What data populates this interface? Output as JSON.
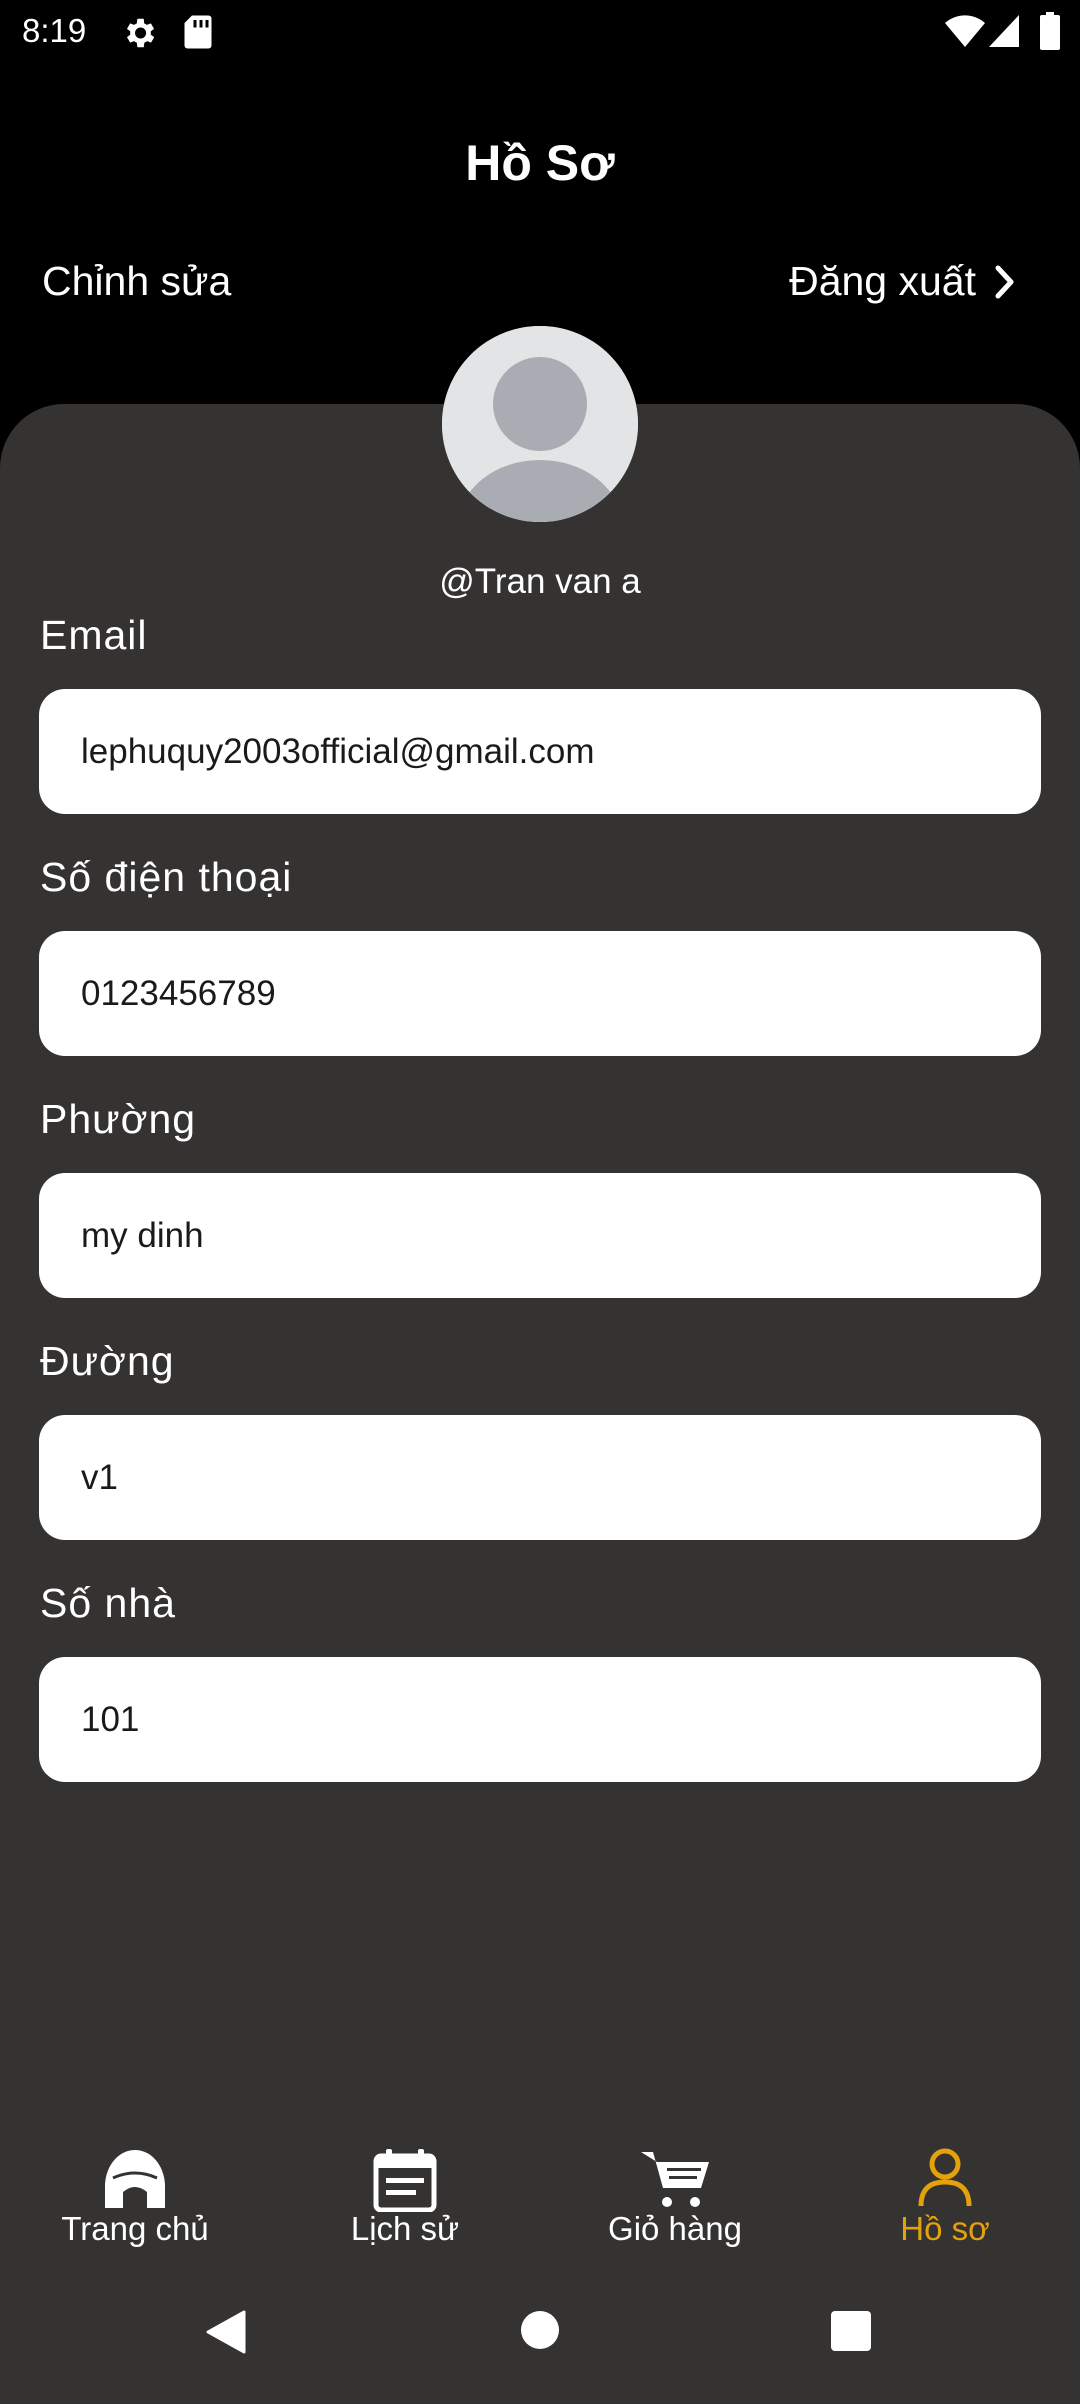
{
  "status_bar": {
    "time": "8:19",
    "icons": [
      "gear-icon",
      "sd-card-icon",
      "wifi-icon",
      "signal-icon",
      "battery-icon"
    ]
  },
  "header": {
    "title": "Hồ Sơ",
    "edit_label": "Chỉnh sửa",
    "logout_label": "Đăng xuất"
  },
  "profile": {
    "username": "@Tran van a"
  },
  "fields": {
    "email": {
      "label": "Email",
      "value": "lephuquy2003official@gmail.com"
    },
    "phone": {
      "label": "Số điện thoại",
      "value": "0123456789"
    },
    "ward": {
      "label": "Phường",
      "value": "my dinh"
    },
    "street": {
      "label": "Đường",
      "value": "v1"
    },
    "house_number": {
      "label": "Số nhà",
      "value": "101"
    }
  },
  "bottom_nav": {
    "items": [
      {
        "label": "Trang chủ",
        "icon": "home-icon"
      },
      {
        "label": "Lịch sử",
        "icon": "calendar-icon"
      },
      {
        "label": "Giỏ hàng",
        "icon": "cart-icon"
      },
      {
        "label": "Hồ sơ",
        "icon": "user-icon"
      }
    ],
    "active_index": 3
  },
  "colors": {
    "background": "#000000",
    "panel": "#353232",
    "input_bg": "#ffffff",
    "active_nav": "#e3a20c"
  }
}
